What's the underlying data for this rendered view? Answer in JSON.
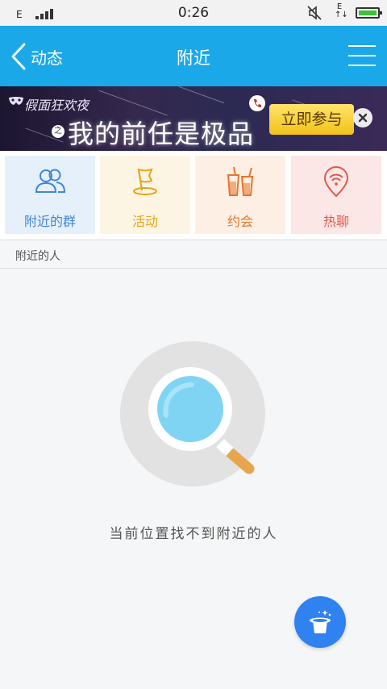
{
  "status_bar": {
    "network": "E",
    "time": "0:26",
    "data_indicator": "E"
  },
  "header": {
    "back_label": "动态",
    "title": "附近"
  },
  "banner": {
    "subtitle": "假面狂欢夜",
    "connector": "之",
    "headline": "我的前任是极品",
    "cta_label": "立即参与"
  },
  "categories": [
    {
      "label": "附近的群",
      "color": "#3f86d7",
      "bg": "#e6f0fb"
    },
    {
      "label": "活动",
      "color": "#e6a317",
      "bg": "#fdf5e3"
    },
    {
      "label": "约会",
      "color": "#e6762e",
      "bg": "#fdefe3"
    },
    {
      "label": "热聊",
      "color": "#e2574c",
      "bg": "#fbe7e5"
    }
  ],
  "section": {
    "title": "附近的人"
  },
  "empty_state": {
    "message": "当前位置找不到附近的人"
  },
  "colors": {
    "accent": "#1aa8e8",
    "fab": "#2f82f0"
  }
}
